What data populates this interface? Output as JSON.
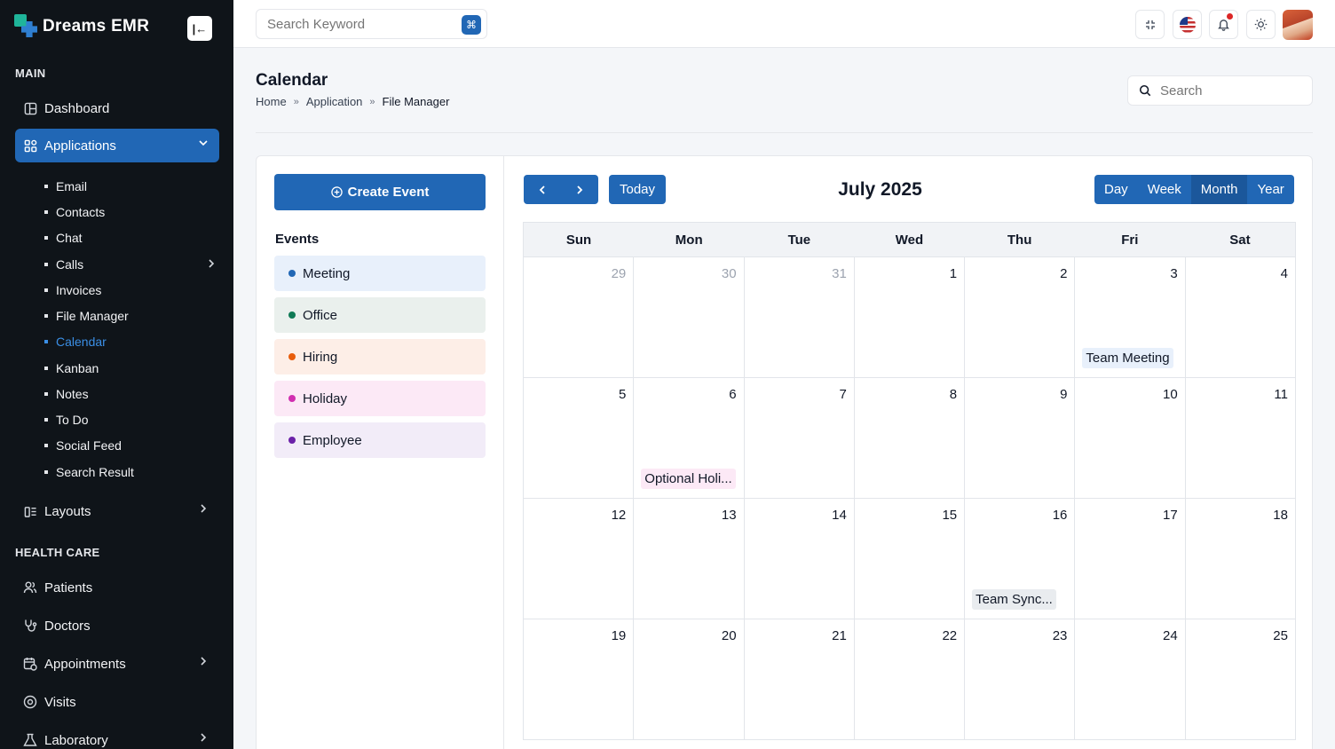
{
  "brand": {
    "name": "Dreams EMR"
  },
  "sidebar": {
    "section_main": "MAIN",
    "dashboard": "Dashboard",
    "applications": "Applications",
    "apps": [
      "Email",
      "Contacts",
      "Chat",
      "Calls",
      "Invoices",
      "File Manager",
      "Calendar",
      "Kanban",
      "Notes",
      "To Do",
      "Social Feed",
      "Search Result"
    ],
    "layouts": "Layouts",
    "section_health": "HEALTH CARE",
    "patients": "Patients",
    "doctors": "Doctors",
    "appointments": "Appointments",
    "visits": "Visits",
    "laboratory": "Laboratory"
  },
  "topbar": {
    "search_placeholder": "Search Keyword"
  },
  "page": {
    "title": "Calendar",
    "breadcrumb": [
      "Home",
      "Application",
      "File Manager"
    ],
    "search_placeholder": "Search"
  },
  "left": {
    "create_label": "Create Event",
    "events_title": "Events",
    "events": [
      {
        "label": "Meeting",
        "dot": "#2167b5",
        "bg": "#e8f0fb"
      },
      {
        "label": "Office",
        "dot": "#0f7a55",
        "bg": "#eaf0ed"
      },
      {
        "label": "Hiring",
        "dot": "#e85d0c",
        "bg": "#fdeee7"
      },
      {
        "label": "Holiday",
        "dot": "#d12fb0",
        "bg": "#fce9f6"
      },
      {
        "label": "Employee",
        "dot": "#6b21a8",
        "bg": "#f2ecf8"
      }
    ]
  },
  "calendar": {
    "today_label": "Today",
    "month_title": "July 2025",
    "views": [
      "Day",
      "Week",
      "Month",
      "Year"
    ],
    "active_view": "Month",
    "weekdays": [
      "Sun",
      "Mon",
      "Tue",
      "Wed",
      "Thu",
      "Fri",
      "Sat"
    ],
    "weeks": [
      [
        "29",
        "30",
        "31",
        "1",
        "2",
        "3",
        "4"
      ],
      [
        "5",
        "6",
        "7",
        "8",
        "9",
        "10",
        "11"
      ],
      [
        "12",
        "13",
        "14",
        "15",
        "16",
        "17",
        "18"
      ],
      [
        "19",
        "20",
        "21",
        "22",
        "23",
        "24",
        "25"
      ]
    ],
    "chips": {
      "team_meeting": "Team Meeting",
      "optional_holiday": "Optional Holi...",
      "team_sync": "Team Sync..."
    }
  }
}
